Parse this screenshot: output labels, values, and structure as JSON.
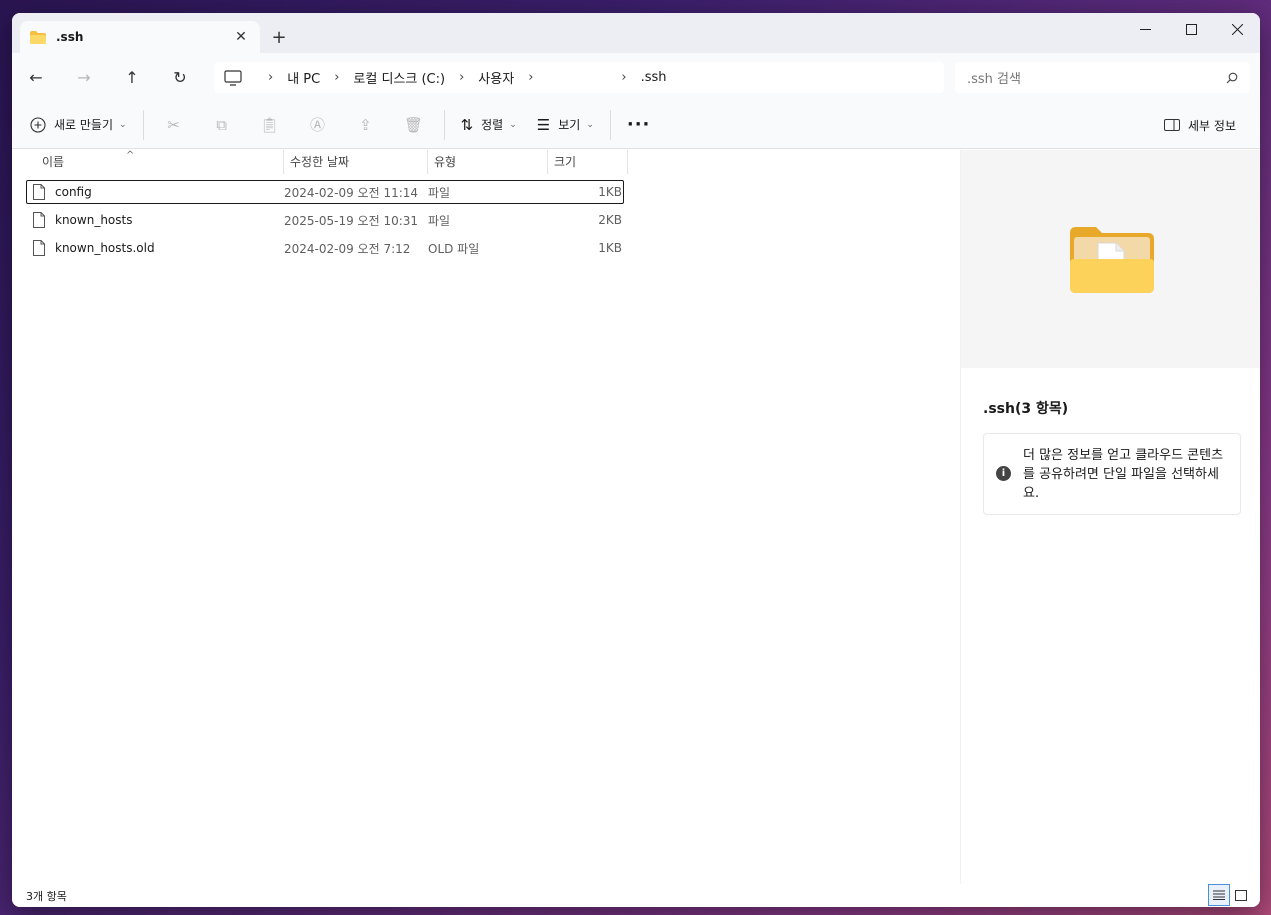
{
  "tab": {
    "title": ".ssh",
    "close_icon": "close-icon",
    "new_tab": "+"
  },
  "window_controls": {
    "minimize": "—",
    "maximize": "☐",
    "close": "✕"
  },
  "nav": {
    "back": "←",
    "forward": "→",
    "up": "↑",
    "refresh": "↻",
    "breadcrumb": [
      "내 PC",
      "로컬 디스크 (C:)",
      "사용자",
      ".ssh"
    ]
  },
  "search": {
    "placeholder": ".ssh 검색"
  },
  "toolbar": {
    "new_label": "새로 만들기",
    "sort_label": "정렬",
    "view_label": "보기",
    "more_label": "···",
    "details_label": "세부 정보"
  },
  "columns": {
    "name": "이름",
    "date": "수정한 날짜",
    "type": "유형",
    "size": "크기"
  },
  "files": [
    {
      "name": "config",
      "date": "2024-02-09 오전 11:14",
      "type": "파일",
      "size": "1KB",
      "selected": true
    },
    {
      "name": "known_hosts",
      "date": "2025-05-19 오전 10:31",
      "type": "파일",
      "size": "2KB",
      "selected": false
    },
    {
      "name": "known_hosts.old",
      "date": "2024-02-09 오전 7:12",
      "type": "OLD 파일",
      "size": "1KB",
      "selected": false
    }
  ],
  "details": {
    "title": ".ssh(3 항목)",
    "info_message": "더 많은 정보를 얻고 클라우드 콘텐츠를 공유하려면 단일 파일을 선택하세요."
  },
  "status": {
    "item_count": "3개 항목"
  },
  "colors": {
    "accent": "#4a8fd8",
    "folder": "#f5c042",
    "tabbar": "#eceef3"
  }
}
